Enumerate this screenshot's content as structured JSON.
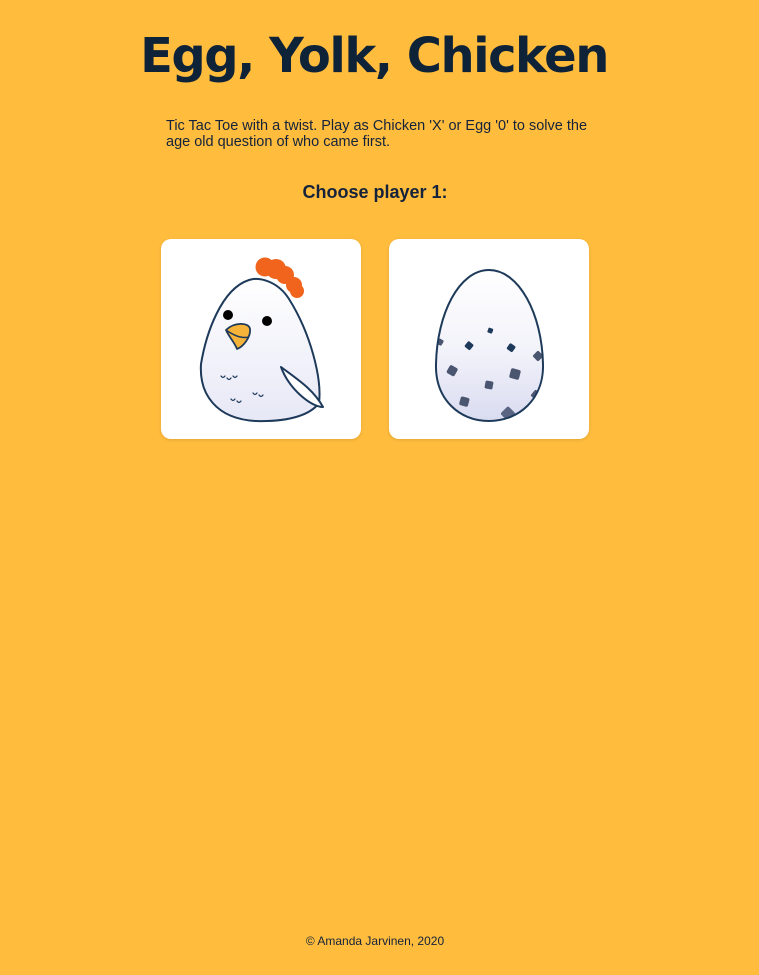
{
  "header": {
    "title": "Egg, Yolk, Chicken"
  },
  "intro": {
    "text": "Tic Tac Toe with a twist. Play as Chicken 'X' or Egg '0' to solve the age old question of who came first."
  },
  "player_select": {
    "heading": "Choose player 1:",
    "options": [
      {
        "name": "Chicken",
        "icon": "chicken-icon"
      },
      {
        "name": "Egg",
        "icon": "egg-icon"
      }
    ]
  },
  "footer": {
    "copyright": "© Amanda Jarvinen, 2020"
  },
  "colors": {
    "background": "#FFBC3D",
    "text": "#14233B",
    "card": "#FFFFFF",
    "comb": "#F0641E",
    "beak": "#F6B33A"
  }
}
